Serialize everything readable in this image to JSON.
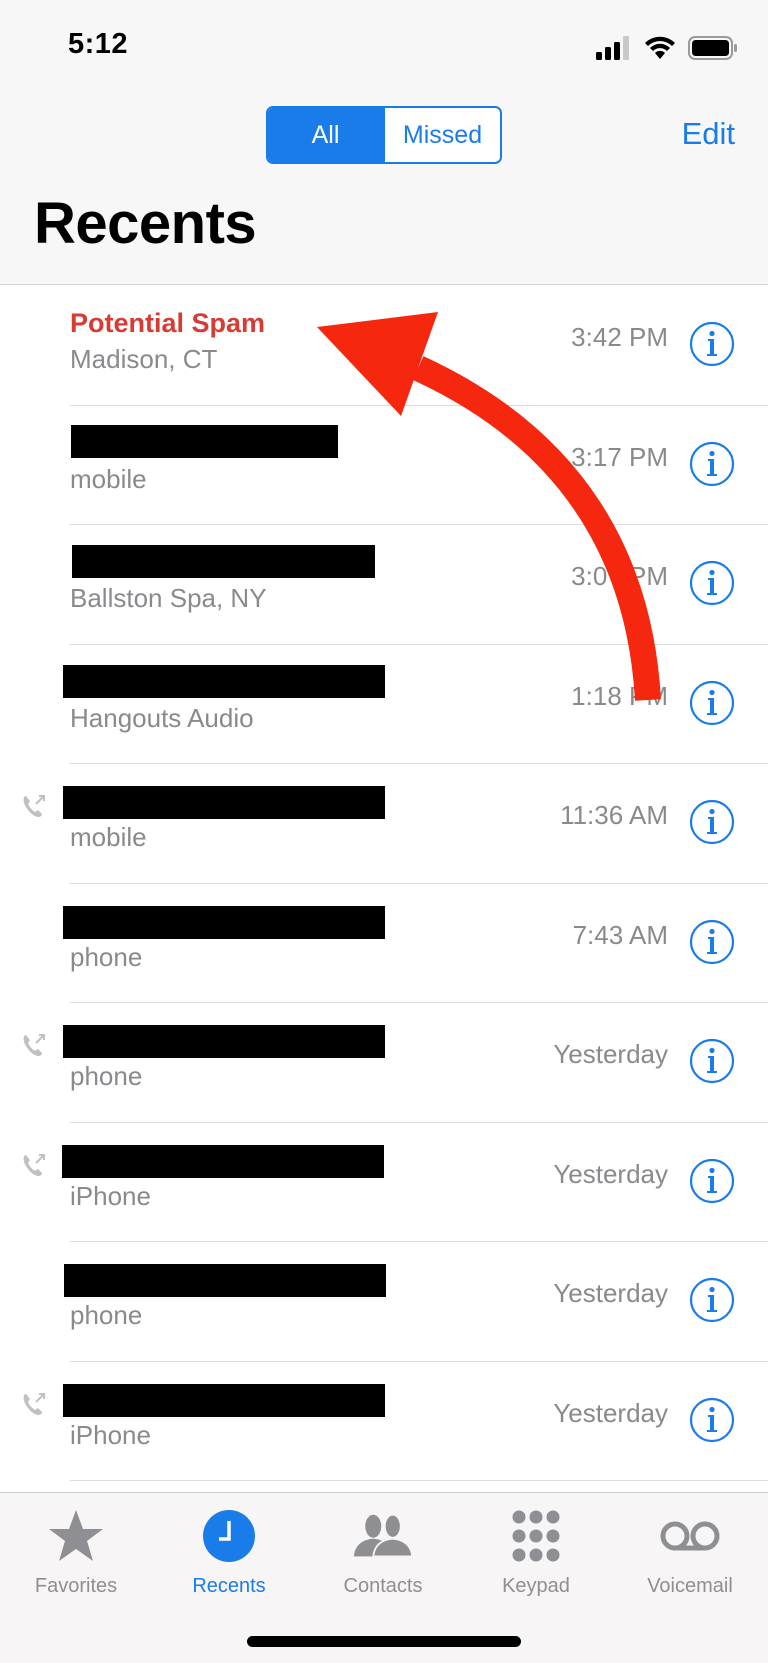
{
  "status_bar": {
    "time": "5:12",
    "icons": [
      "cellular-signal-icon",
      "wifi-icon",
      "battery-icon"
    ]
  },
  "nav": {
    "segments": [
      {
        "label": "All",
        "selected": true
      },
      {
        "label": "Missed",
        "selected": false
      }
    ],
    "edit_label": "Edit",
    "title": "Recents"
  },
  "calls": [
    {
      "name": "Potential Spam",
      "name_redacted": false,
      "spam": true,
      "detail": "Madison, CT",
      "time": "3:42 PM",
      "outgoing": false
    },
    {
      "name": "",
      "name_redacted": true,
      "spam": false,
      "detail": "mobile",
      "time": "3:17 PM",
      "outgoing": false
    },
    {
      "name": "",
      "name_redacted": true,
      "spam": false,
      "detail": "Ballston Spa, NY",
      "time": "3:0? PM",
      "outgoing": false
    },
    {
      "name": "",
      "name_redacted": true,
      "spam": false,
      "detail": "Hangouts Audio",
      "time": "1:18 PM",
      "outgoing": false
    },
    {
      "name": "",
      "name_redacted": true,
      "spam": false,
      "detail": "mobile",
      "time": "11:36 AM",
      "outgoing": true
    },
    {
      "name": "",
      "name_redacted": true,
      "spam": false,
      "detail": "phone",
      "time": "7:43 AM",
      "outgoing": false
    },
    {
      "name": "",
      "name_redacted": true,
      "spam": false,
      "detail": "phone",
      "time": "Yesterday",
      "outgoing": true
    },
    {
      "name": "",
      "name_redacted": true,
      "spam": false,
      "detail": "iPhone",
      "time": "Yesterday",
      "outgoing": true
    },
    {
      "name": "",
      "name_redacted": true,
      "spam": false,
      "detail": "phone",
      "time": "Yesterday",
      "outgoing": false
    },
    {
      "name": "",
      "name_redacted": true,
      "spam": false,
      "detail": "iPhone",
      "time": "Yesterday",
      "outgoing": true
    }
  ],
  "annotation": {
    "type": "curved-arrow",
    "color": "#f5280f",
    "points_to": "Potential Spam"
  },
  "tabbar": {
    "tabs": [
      {
        "label": "Favorites",
        "icon": "star-icon",
        "active": false
      },
      {
        "label": "Recents",
        "icon": "clock-icon",
        "active": true
      },
      {
        "label": "Contacts",
        "icon": "contacts-icon",
        "active": false
      },
      {
        "label": "Keypad",
        "icon": "keypad-icon",
        "active": false
      },
      {
        "label": "Voicemail",
        "icon": "voicemail-icon",
        "active": false
      }
    ]
  },
  "colors": {
    "accent": "#1a7ce8",
    "spam_red": "#d83a34",
    "secondary_text": "#8a8a8e",
    "arrow": "#f5280f"
  }
}
